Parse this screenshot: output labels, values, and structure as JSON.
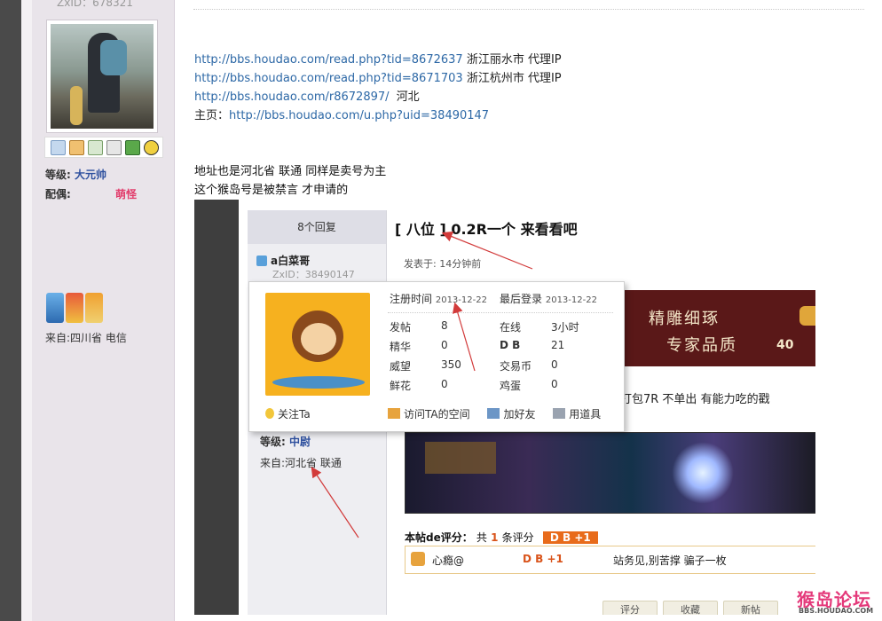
{
  "sidebar": {
    "zxid": "ZxID：678321",
    "level_label": "等级:",
    "level_value": "大元帅",
    "spouse_label": "配偶:",
    "spouse_value": "萌怪",
    "from": "来自:四川省 电信"
  },
  "post": {
    "links": [
      {
        "url": "http://bbs.houdao.com/read.php?tid=8672637",
        "note": "浙江丽水市 代理IP"
      },
      {
        "url": "http://bbs.houdao.com/read.php?tid=8671703",
        "note": "浙江杭州市 代理IP"
      },
      {
        "url": "http://bbs.houdao.com/r8672897/",
        "note": "河北"
      }
    ],
    "homepage_label": "主页：",
    "homepage_url": "http://bbs.houdao.com/u.php?uid=38490147",
    "note1": "地址也是河北省  联通   同样是卖号为主",
    "note2": "这个猴岛号是被禁言  才申请的"
  },
  "embedded": {
    "reply_count": "8个回复",
    "title": "[ 八位 ] 0.2R一个 来看看吧",
    "posted_at": "发表于: 14分钟前",
    "user_name": "a白菜哥",
    "user_zxid": "ZxID：38490147",
    "user_level_label": "等级:",
    "user_level_value": "中尉",
    "user_from": "来自:河北省 联通",
    "banner_line1": "精雕细琢",
    "banner_line2": "专家品质",
    "banner_num": "40",
    "tail_text": "打包7R 不单出 有能力吃的戳",
    "rating_label": "本帖de评分：",
    "rating_prefix": "共",
    "rating_count": "1",
    "rating_suffix": "条评分",
    "rating_badge": "D B +1",
    "rate_user": "心瘾@",
    "rate_score": "D B +1",
    "rate_comment": "站务见,别苦撑 骗子一枚",
    "buttons": [
      "评分",
      "收藏",
      "新帖"
    ]
  },
  "popup": {
    "reg_label": "注册时间",
    "reg_value": "2013-12-22",
    "last_label": "最后登录",
    "last_value": "2013-12-22",
    "stats": [
      {
        "label": "发帖",
        "value": "8"
      },
      {
        "label": "在线",
        "value": "3小时"
      },
      {
        "label": "精华",
        "value": "0"
      },
      {
        "label": "D B",
        "value": "21"
      },
      {
        "label": "威望",
        "value": "350"
      },
      {
        "label": "交易币",
        "value": "0"
      },
      {
        "label": "鲜花",
        "value": "0"
      },
      {
        "label": "鸡蛋",
        "value": "0"
      }
    ],
    "follow": "关注Ta",
    "visit": "访问TA的空间",
    "add_friend": "加好友",
    "use_tool": "用道具"
  },
  "watermark": {
    "text": "猴岛论坛",
    "sub": "BBS.HOUDAO.COM"
  },
  "colors": {
    "link": "#2d68a6",
    "arrow": "#d23a3a",
    "badge": "#e86b1b"
  }
}
